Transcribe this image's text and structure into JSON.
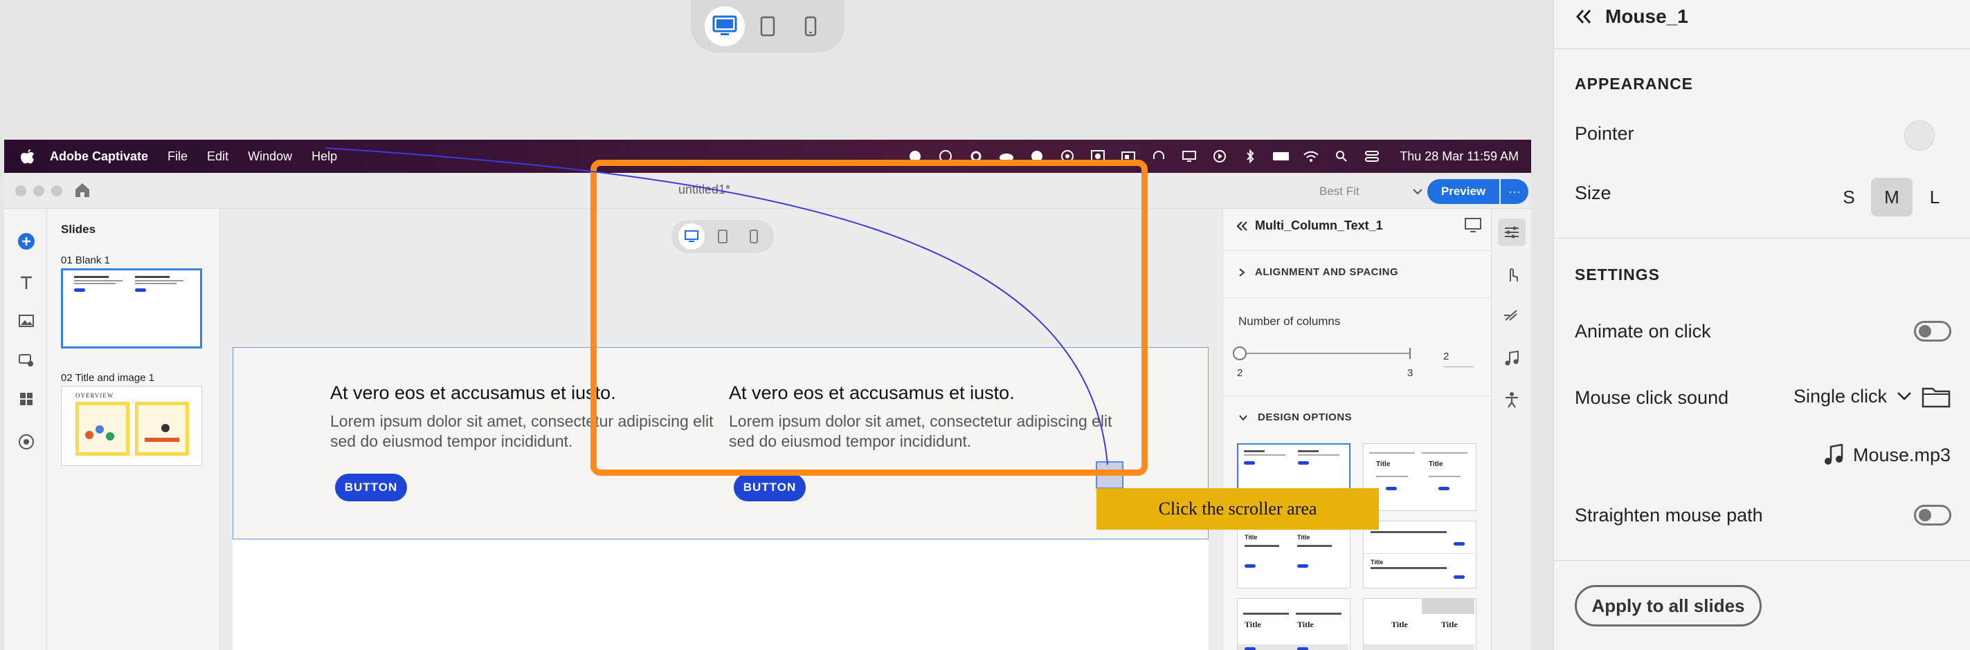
{
  "device_switcher": {
    "options": [
      "desktop",
      "tablet",
      "mobile"
    ],
    "active": "desktop"
  },
  "mac": {
    "menubar": {
      "app": "Adobe Captivate",
      "menus": [
        "File",
        "Edit",
        "Window",
        "Help"
      ],
      "clock": "Thu 28 Mar  11:59 AM"
    },
    "document_title": "untitled1*",
    "fit": "Best Fit",
    "preview_label": "Preview",
    "more_label": "···",
    "slides": {
      "title": "Slides",
      "items": [
        {
          "label": "01  Blank 1"
        },
        {
          "label": "02  Title and image 1",
          "thumb_heading": "OVERVIEW"
        }
      ]
    },
    "canvas": {
      "columns": [
        {
          "title": "At vero eos et accusamus et iusto.",
          "body": "Lorem ipsum dolor sit amet, consectetur adipiscing elit sed do eiusmod tempor incididunt.",
          "button": "BUTTON"
        },
        {
          "title": "At vero eos et accusamus et iusto.",
          "body": "Lorem ipsum dolor sit amet, consectetur adipiscing elit sed do eiusmod tempor incididunt.",
          "button": "BUTTON"
        }
      ]
    },
    "properties": {
      "object_name": "Multi_Column_Text_1",
      "alignment_section": "ALIGNMENT AND SPACING",
      "columns_label": "Number of columns",
      "slider_min": "2",
      "slider_max": "3",
      "columns_value": "2",
      "design_section": "DESIGN OPTIONS",
      "thumb_title": "Title"
    }
  },
  "callout": {
    "text": "Click the  scroller area"
  },
  "inspector": {
    "title": "Mouse_1",
    "appearance": "APPEARANCE",
    "pointer_label": "Pointer",
    "size_label": "Size",
    "size_options": [
      "S",
      "M",
      "L"
    ],
    "size_selected": "M",
    "settings": "SETTINGS",
    "animate_label": "Animate on click",
    "animate_on": false,
    "sound_label": "Mouse click sound",
    "sound_value": "Single click",
    "sound_file": "Mouse.mp3",
    "straighten_label": "Straighten mouse path",
    "straighten_on": false,
    "apply_label": "Apply to all slides"
  },
  "colors": {
    "accent": "#1e6fe0",
    "highlight": "#ff8a1c",
    "callout": "#e8b10c",
    "mouse_path": "#3a3ae0"
  }
}
